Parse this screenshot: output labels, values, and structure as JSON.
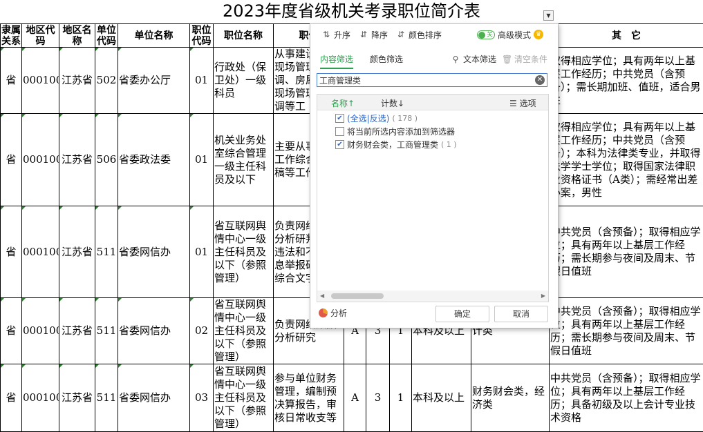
{
  "title": "2023年度省级机关考录职位简介表",
  "headers": [
    "隶属关系",
    "地区代码",
    "地区名称",
    "单位代码",
    "单位名称",
    "职位代码",
    "职位名称",
    "职位",
    "",
    "",
    "",
    "",
    "",
    "其　它"
  ],
  "rows": [
    {
      "rel": "省",
      "area_code": "000100",
      "area": "江苏省",
      "unit_code": "502",
      "unit": "省委办公厅",
      "pos_code": "01",
      "pos_name": "行政处（保卫处）一级科员",
      "desc": "从事建设工作现场管理、协调、房屋维护现场管理、协调等工",
      "other": "取得相应学位；具有两年以上基层工作经历；中共党员（含预备）；需长期加班、值班，适合男性"
    },
    {
      "rel": "省",
      "area_code": "000100",
      "area": "江苏省",
      "unit_code": "506",
      "unit": "省委政法委",
      "pos_code": "01",
      "pos_name": "机关业务处室综合管理一级主任科员及以下",
      "desc": "主要从事专项工作综合性文稿等工作",
      "other": "取得相应学位；具有两年以上基层工作经历；中共党员（含预备）；本科为法律类专业，并取得法学学士学位；取得国家法律职业资格证书（A类）；需经常出差办案，男性"
    },
    {
      "rel": "省",
      "area_code": "000100",
      "area": "江苏省",
      "unit_code": "511",
      "unit": "省委网信办",
      "pos_code": "01",
      "pos_name": "省互联网舆情中心一级主任科员及以下（参照管理）",
      "desc": "负责网络舆情分析研判网络违法和不良信息举报研处，综合文字",
      "other": "中共党员（含预备）；取得相应学位；具有两年以上基层工作经历；需长期参与夜间及周末、节假日值班"
    },
    {
      "rel": "省",
      "area_code": "000100",
      "area": "江苏省",
      "unit_code": "511",
      "unit": "省委网信办",
      "pos_code": "02",
      "pos_name": "省互联网舆情中心一级主任科员及以下（参照管理）",
      "desc": "负责网络数据分析研究",
      "extra": [
        "A",
        "3",
        "1",
        "本科及以上",
        "计类"
      ],
      "other": "中共党员（含预备）；取得相应学位；具有两年以上基层工作经历；需长期参与夜间及周末、节假日值班"
    },
    {
      "rel": "省",
      "area_code": "000100",
      "area": "江苏省",
      "unit_code": "511",
      "unit": "省委网信办",
      "pos_code": "03",
      "pos_name": "省互联网舆情中心一级主任科员及以下（参照管理）",
      "desc": "参与单位财务管理，编制预决算报告，审核日常收支等",
      "extra": [
        "A",
        "3",
        "1",
        "本科及以上",
        "财务财会类，经济类"
      ],
      "other": "中共党员（含预备）；取得相应学位；具有两年以上基层工作经历；具备初级及以上会计专业技术资格"
    }
  ],
  "popup": {
    "toolbar": {
      "asc": "升序",
      "desc": "降序",
      "color_sort": "颜色排序",
      "toggle_text": "关",
      "advanced": "高级模式"
    },
    "tabs": {
      "content": "内容筛选",
      "color": "颜色筛选"
    },
    "text_filter": "文本筛选",
    "clear": "清空条件",
    "search_value": "工商管理类",
    "list_header": {
      "name": "名称",
      "count": "计数",
      "options": "选项"
    },
    "items": [
      {
        "label": "(全选|反选)",
        "count": "( 178 )",
        "checked": true
      },
      {
        "label": "将当前所选内容添加到筛选器",
        "count": "",
        "checked": false
      },
      {
        "label": "财务财会类，工商管理类",
        "count": "( 1 )",
        "checked": true
      }
    ],
    "analyze": "分析",
    "ok": "确定",
    "cancel": "取消"
  }
}
